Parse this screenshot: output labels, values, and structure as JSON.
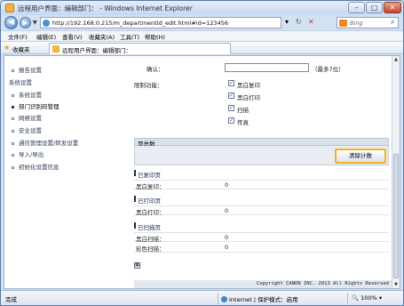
{
  "window": {
    "title": "远程用户界面：编辑部门： - Windows Internet Explorer",
    "min_glyph": "–",
    "max_glyph": "□",
    "close_glyph": "✕"
  },
  "address_bar": {
    "url": "http://192.168.0.215/m_departmentId_edit.html#id=123456",
    "search_placeholder": "Bing",
    "refresh_glyph": "↻",
    "stop_glyph": "✕"
  },
  "menu": [
    "文件(F)",
    "编辑(E)",
    "查看(V)",
    "收藏夹(A)",
    "工具(T)",
    "帮助(H)"
  ],
  "favorites": {
    "label": "收藏夹",
    "tab_title": "远程用户界面：编辑部门："
  },
  "sidebar": {
    "top_item": "报告设置",
    "section": "系统设置",
    "items": [
      {
        "label": "系统设置",
        "active": false
      },
      {
        "label": "部门识别码管理",
        "active": true
      },
      {
        "label": "网络设置",
        "active": false
      },
      {
        "label": "安全设置",
        "active": false
      },
      {
        "label": "通信管理设置/转发设置",
        "active": false
      },
      {
        "label": "导入/导出",
        "active": false
      },
      {
        "label": "初始化设置信息",
        "active": false
      }
    ]
  },
  "form": {
    "confirm_label": "确认：",
    "confirm_value": "",
    "confirm_hint": "（最多7位）",
    "restrict_label": "限制功能：",
    "restrictions": [
      {
        "label": "黑白复印",
        "checked": true
      },
      {
        "label": "黑白打印",
        "checked": true
      },
      {
        "label": "扫描",
        "checked": true
      },
      {
        "label": "传真",
        "checked": true
      }
    ]
  },
  "page_count": {
    "header": "页总数",
    "clear_button": "清除计数",
    "sections": [
      {
        "title": "已复印页",
        "rows": [
          {
            "label": "黑白复印：",
            "value": "0"
          }
        ]
      },
      {
        "title": "已打印页",
        "rows": [
          {
            "label": "黑白打印：",
            "value": "0"
          }
        ]
      },
      {
        "title": "已扫描页",
        "rows": [
          {
            "label": "黑白扫描：",
            "value": "0"
          },
          {
            "label": "彩色扫描：",
            "value": "0"
          }
        ]
      }
    ]
  },
  "copyright": "Copyright CANON INC. 2013 All Rights Reserved",
  "status": {
    "left": "完成",
    "zone": "Internet | 保护模式：启用",
    "zoom": "100%"
  }
}
